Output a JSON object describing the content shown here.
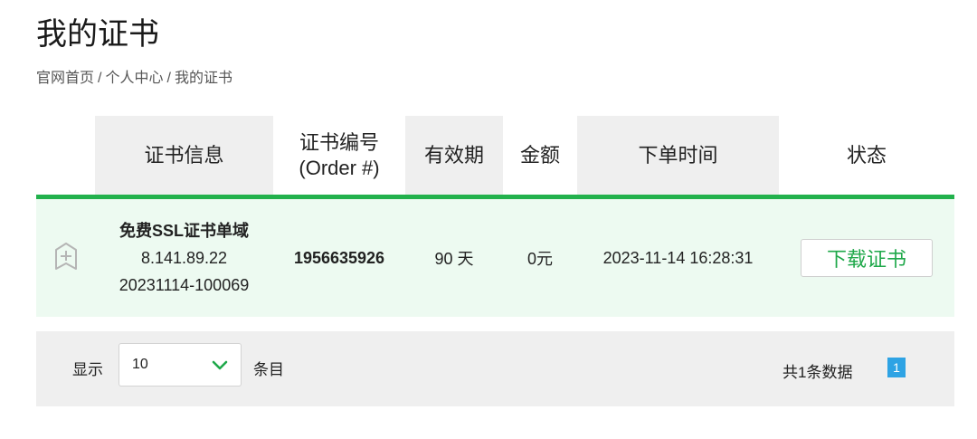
{
  "page_title": "我的证书",
  "breadcrumb": {
    "items": [
      "官网首页",
      "个人中心",
      "我的证书"
    ],
    "separator": "/"
  },
  "table": {
    "headers": {
      "info": "证书信息",
      "order_line1": "证书编号",
      "order_line2": "(Order #)",
      "validity": "有效期",
      "amount": "金额",
      "time": "下单时间",
      "status": "状态"
    },
    "rows": [
      {
        "icon": "badge-icon",
        "cert_name": "免费SSL证书单域",
        "domain": "8.141.89.22",
        "cert_id": "20231114-100069",
        "order_number": "1956635926",
        "validity": "90 天",
        "amount": "0元",
        "order_time": "2023-11-14 16:28:31",
        "action_label": "下载证书"
      }
    ]
  },
  "pagination": {
    "show_label": "显示",
    "page_size": "10",
    "entries_label": "条目",
    "total_label": "共1条数据",
    "current_page": "1"
  },
  "colors": {
    "accent_green": "#22b14c",
    "row_bg": "#edfaf1",
    "header_bg": "#efefef",
    "page_btn": "#2ea3e4"
  }
}
